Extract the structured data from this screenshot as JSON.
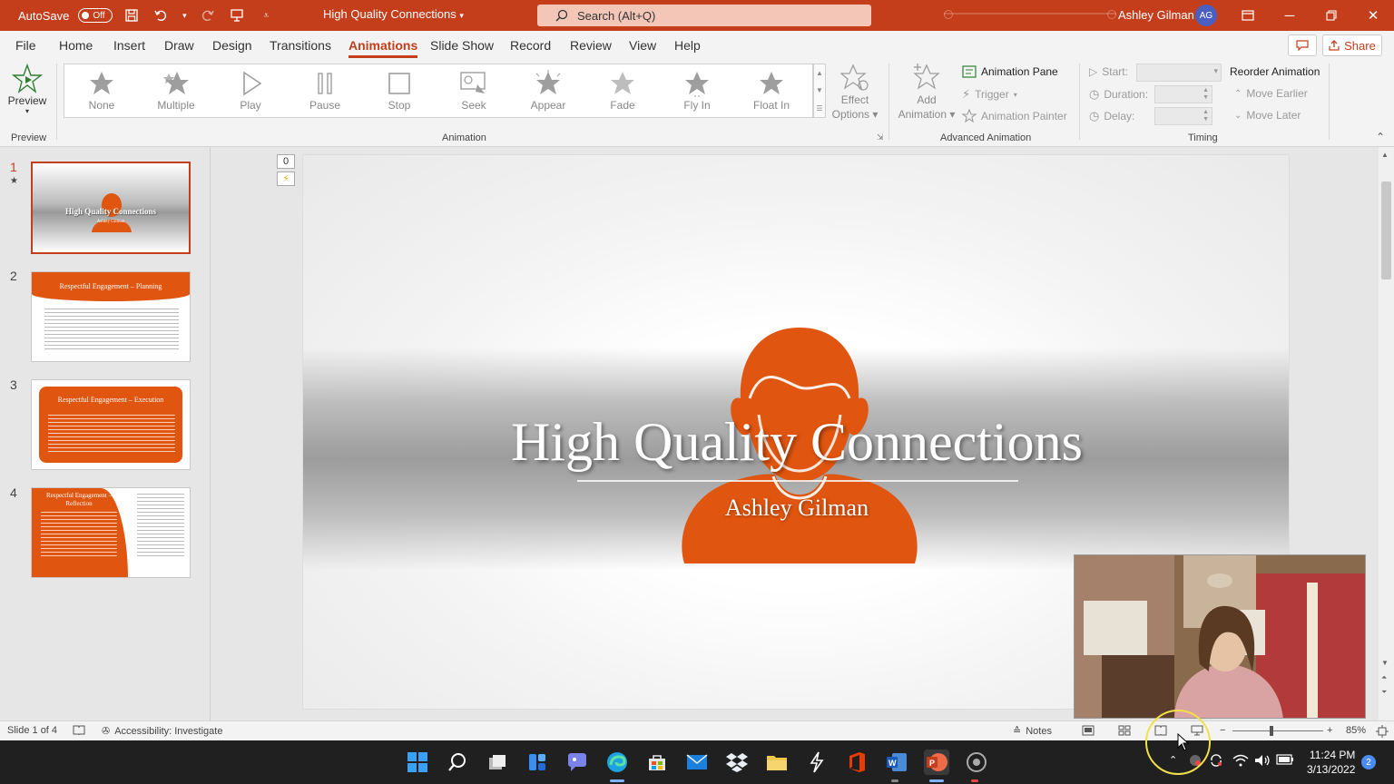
{
  "titlebar": {
    "autosave_label": "AutoSave",
    "autosave_state": "Off",
    "doc_title": "High Quality Connections",
    "search_placeholder": "Search (Alt+Q)",
    "user_name": "Ashley Gilman",
    "user_initials": "AG"
  },
  "menu": {
    "tabs": [
      "File",
      "Home",
      "Insert",
      "Draw",
      "Design",
      "Transitions",
      "Animations",
      "Slide Show",
      "Record",
      "Review",
      "View",
      "Help"
    ],
    "active": "Animations",
    "share_label": "Share"
  },
  "ribbon": {
    "preview": {
      "label": "Preview",
      "group": "Preview"
    },
    "animation_group": "Animation",
    "gallery": [
      "None",
      "Multiple",
      "Play",
      "Pause",
      "Stop",
      "Seek",
      "Appear",
      "Fade",
      "Fly In",
      "Float In"
    ],
    "effect_options": [
      "Effect",
      "Options"
    ],
    "advanced": {
      "group": "Advanced Animation",
      "add_animation": [
        "Add",
        "Animation"
      ],
      "animation_pane": "Animation Pane",
      "trigger": "Trigger",
      "animation_painter": "Animation Painter"
    },
    "timing": {
      "group": "Timing",
      "start": "Start:",
      "duration": "Duration:",
      "delay": "Delay:",
      "reorder": "Reorder Animation",
      "move_earlier": "Move Earlier",
      "move_later": "Move Later"
    }
  },
  "thumbnails": [
    {
      "num": "1",
      "title": "High Quality Connections",
      "subtitle": "Ashley Gilman"
    },
    {
      "num": "2",
      "title": "Respectful Engagement – Planning"
    },
    {
      "num": "3",
      "title": "Respectful Engagement – Execution"
    },
    {
      "num": "4",
      "title": "Respectful Engagement – Reflection"
    }
  ],
  "slide": {
    "anim_count": "0",
    "title": "High Quality Connections",
    "subtitle": "Ashley Gilman"
  },
  "status": {
    "slide_info": "Slide 1 of 4",
    "accessibility": "Accessibility: Investigate",
    "notes": "Notes",
    "zoom": "85%"
  },
  "taskbar": {
    "time": "11:24 PM",
    "date": "3/13/2022",
    "notifications": "2"
  },
  "colors": {
    "accent": "#c43e1c",
    "slide_orange": "#e0550f"
  }
}
